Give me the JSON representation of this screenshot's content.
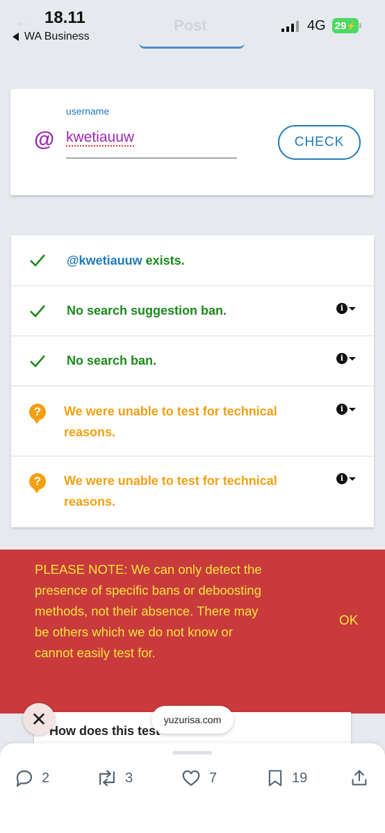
{
  "status_bar": {
    "time": "18.11",
    "back_app": "WA Business",
    "ghost_title": "Post",
    "network": "4G",
    "battery": "29"
  },
  "form": {
    "field_label": "username",
    "username": "kwetiauuw",
    "check_label": "CHECK"
  },
  "results": [
    {
      "status": "ok",
      "prefix": "@kwetiauuw",
      "text": " exists."
    },
    {
      "status": "ok",
      "text": "No search suggestion ban."
    },
    {
      "status": "ok",
      "text": "No search ban."
    },
    {
      "status": "unknown",
      "text": "We were unable to test for technical reasons."
    },
    {
      "status": "unknown",
      "text": "We were unable to test for technical reasons."
    }
  ],
  "notice": {
    "text": "PLEASE NOTE: We can only detect the presence of specific bans or deboosting methods, not their absence. There may be others which we do not know or cannot easily test for.",
    "ok_label": "OK"
  },
  "faq": {
    "title": "How does this test"
  },
  "overlay": {
    "domain": "yuzurisa.com"
  },
  "actions": {
    "replies": "2",
    "reposts": "3",
    "likes": "7",
    "bookmarks": "19"
  },
  "colors": {
    "accent_blue": "#1f7ab8",
    "success_green": "#1b8a1b",
    "warning_orange": "#f2a012",
    "notice_red": "#c93a3c",
    "notice_text_yellow": "#f4e53b",
    "at_purple": "#9c27b0"
  },
  "icons": {
    "ok": "check-icon",
    "unknown": "question-bubble-icon",
    "info": "info-icon",
    "caret": "caret-down-icon",
    "reply": "reply-icon",
    "repost": "repost-icon",
    "like": "heart-icon",
    "bookmark": "bookmark-icon",
    "share": "share-icon",
    "close": "close-icon"
  }
}
